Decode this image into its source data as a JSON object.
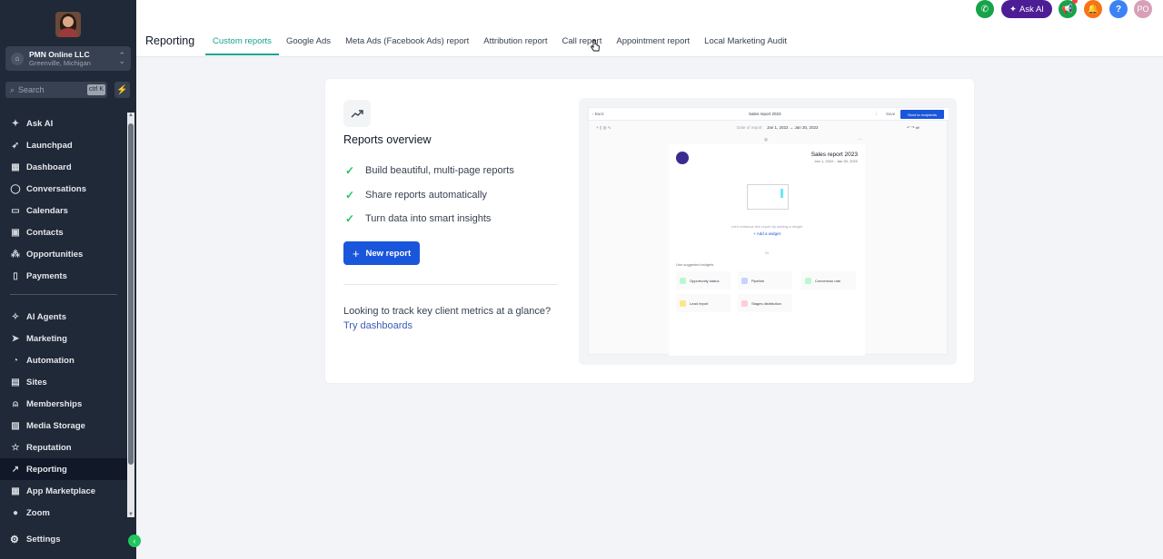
{
  "sidebar": {
    "account": {
      "name": "PMN Online LLC",
      "location": "Greenville, Michigan"
    },
    "search": {
      "placeholder": "Search",
      "shortcut": "ctrl K"
    },
    "nav_primary": [
      {
        "label": "Ask AI",
        "icon": "sparkle-icon",
        "glyph": "✦"
      },
      {
        "label": "Launchpad",
        "icon": "rocket-icon",
        "glyph": "➶"
      },
      {
        "label": "Dashboard",
        "icon": "dashboard-icon",
        "glyph": "▦"
      },
      {
        "label": "Conversations",
        "icon": "chat-icon",
        "glyph": "◯"
      },
      {
        "label": "Calendars",
        "icon": "calendar-icon",
        "glyph": "▭"
      },
      {
        "label": "Contacts",
        "icon": "contacts-icon",
        "glyph": "▣"
      },
      {
        "label": "Opportunities",
        "icon": "opportunities-icon",
        "glyph": "⁂"
      },
      {
        "label": "Payments",
        "icon": "payments-icon",
        "glyph": "▯"
      }
    ],
    "nav_secondary": [
      {
        "label": "AI Agents",
        "icon": "ai-agents-icon",
        "glyph": "✧"
      },
      {
        "label": "Marketing",
        "icon": "send-icon",
        "glyph": "➤"
      },
      {
        "label": "Automation",
        "icon": "automation-icon",
        "glyph": "◔"
      },
      {
        "label": "Sites",
        "icon": "sites-icon",
        "glyph": "▤"
      },
      {
        "label": "Memberships",
        "icon": "memberships-icon",
        "glyph": "⍝"
      },
      {
        "label": "Media Storage",
        "icon": "media-icon",
        "glyph": "▨"
      },
      {
        "label": "Reputation",
        "icon": "star-icon",
        "glyph": "☆"
      },
      {
        "label": "Reporting",
        "icon": "trend-icon",
        "glyph": "↗"
      },
      {
        "label": "App Marketplace",
        "icon": "apps-icon",
        "glyph": "▦"
      },
      {
        "label": "Zoom",
        "icon": "zoom-icon",
        "glyph": "●"
      }
    ],
    "settings": {
      "label": "Settings",
      "glyph": "⚙"
    }
  },
  "header": {
    "title": "Reporting",
    "tabs": [
      "Custom reports",
      "Google Ads",
      "Meta Ads (Facebook Ads) report",
      "Attribution report",
      "Call report",
      "Appointment report",
      "Local Marketing Audit"
    ],
    "ask_ai": "Ask AI",
    "user_initials": "PO"
  },
  "card": {
    "title": "Reports overview",
    "benefits": [
      "Build beautiful, multi-page reports",
      "Share reports automatically",
      "Turn data into smart insights"
    ],
    "new_report": "New report",
    "looking_text": "Looking to track key client metrics at a glance?",
    "try_link": "Try dashboards"
  },
  "preview": {
    "back": "Back",
    "report_name": "Sales report 2023",
    "save": "Save",
    "share": "Send to recipients",
    "date_label": "Date of report",
    "date_range": "Jan 1, 2022 → Jan 30, 2022",
    "page_title": "Sales report 2023",
    "page_sub": "Jan 1, 2022 - Jan 30, 2022",
    "hint": "Let's enhance this report by adding a widget",
    "add_widget": "+ Add a widget",
    "or": "Or",
    "suggested": "Use suggested widgets",
    "chips": [
      {
        "label": "Opportunity status",
        "color": "#bbf7d0"
      },
      {
        "label": "Pipeline",
        "color": "#c7d2fe"
      },
      {
        "label": "Conversion rate",
        "color": "#bbf7d0"
      },
      {
        "label": "Lead report",
        "color": "#fde68a"
      },
      {
        "label": "Stages distribution",
        "color": "#fecdd3"
      }
    ]
  },
  "colors": {
    "sidebar_bg": "#1f2937",
    "accent_tab": "#16a394",
    "primary_button": "#1a56db",
    "check": "#22c55e"
  }
}
